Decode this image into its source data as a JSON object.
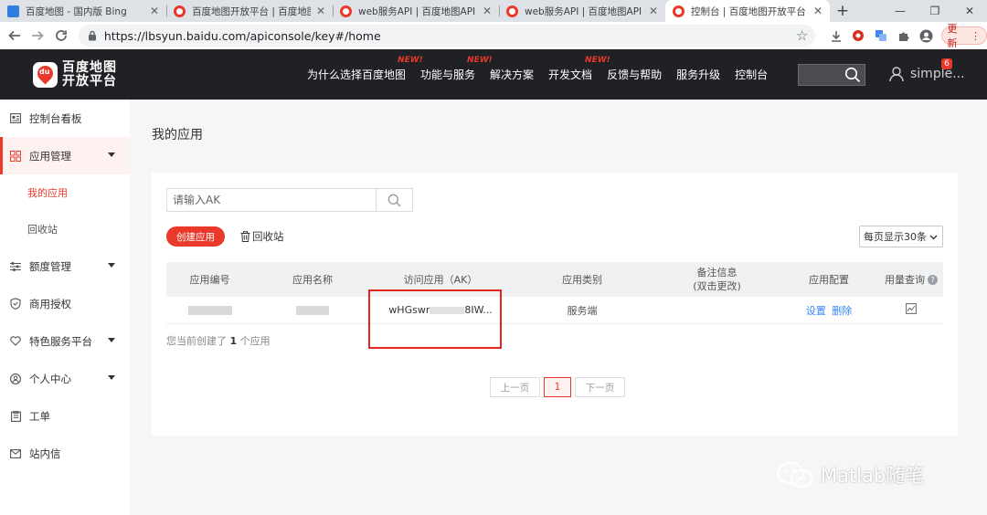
{
  "browser": {
    "tabs": [
      {
        "title": "百度地图 - 国内版 Bing",
        "favicon": "bing-icon"
      },
      {
        "title": "百度地图开放平台 | 百度地图A",
        "favicon": "baidu-map-icon"
      },
      {
        "title": "web服务API | 百度地图API SD",
        "favicon": "baidu-map-icon"
      },
      {
        "title": "web服务API | 百度地图API SD",
        "favicon": "baidu-map-icon"
      },
      {
        "title": "控制台 | 百度地图开放平台",
        "favicon": "baidu-map-icon",
        "active": true
      }
    ],
    "new_tab": "+",
    "url": "https://lbsyun.baidu.com/apiconsole/key#/home",
    "update_label": "更新"
  },
  "site": {
    "logo_line1": "百度地图",
    "logo_line2": "开放平台",
    "nav": [
      {
        "label": "为什么选择百度地图",
        "tag": ""
      },
      {
        "label": "功能与服务",
        "tag": "NEW!"
      },
      {
        "label": "解决方案",
        "tag": "NEW!"
      },
      {
        "label": "开发文档",
        "tag": "NEW!"
      },
      {
        "label": "反馈与帮助",
        "tag": ""
      },
      {
        "label": "服务升级",
        "tag": ""
      },
      {
        "label": "控制台",
        "tag": ""
      }
    ],
    "user_name": "simple...",
    "user_badge": "6"
  },
  "sidebar": {
    "items": [
      {
        "label": "控制台看板",
        "icon": "dashboard-icon"
      },
      {
        "label": "应用管理",
        "icon": "grid-icon",
        "active": true,
        "expandable": true
      },
      {
        "label": "额度管理",
        "icon": "sliders-icon",
        "expandable": true
      },
      {
        "label": "商用授权",
        "icon": "shield-icon"
      },
      {
        "label": "特色服务平台",
        "icon": "heart-icon",
        "expandable": true
      },
      {
        "label": "个人中心",
        "icon": "person-icon",
        "expandable": true
      },
      {
        "label": "工单",
        "icon": "clipboard-icon"
      },
      {
        "label": "站内信",
        "icon": "mail-icon"
      }
    ],
    "sub_items": [
      {
        "label": "我的应用",
        "current": true
      },
      {
        "label": "回收站"
      }
    ]
  },
  "main": {
    "title": "我的应用",
    "search_placeholder": "请输入AK",
    "create_label": "创建应用",
    "recycle_label": "回收站",
    "page_size_label": "每页显示30条",
    "columns": [
      "应用编号",
      "应用名称",
      "访问应用（AK）",
      "应用类别",
      "备注信息",
      "(双击更改)",
      "应用配置",
      "用量查询"
    ],
    "row": {
      "ak_prefix": "wHGswr",
      "ak_suffix": "8IW...",
      "category": "服务端",
      "config_set": "设置",
      "config_delete": "删除"
    },
    "count_prefix": "您当前创建了",
    "count_value": "1",
    "count_suffix": "个应用",
    "pager": {
      "prev": "上一页",
      "current": "1",
      "next": "下一页"
    }
  },
  "watermark": "Matlab随笔",
  "colors": {
    "brand": "#e8392b",
    "header_bg": "#1f2124",
    "link": "#3385ff"
  }
}
